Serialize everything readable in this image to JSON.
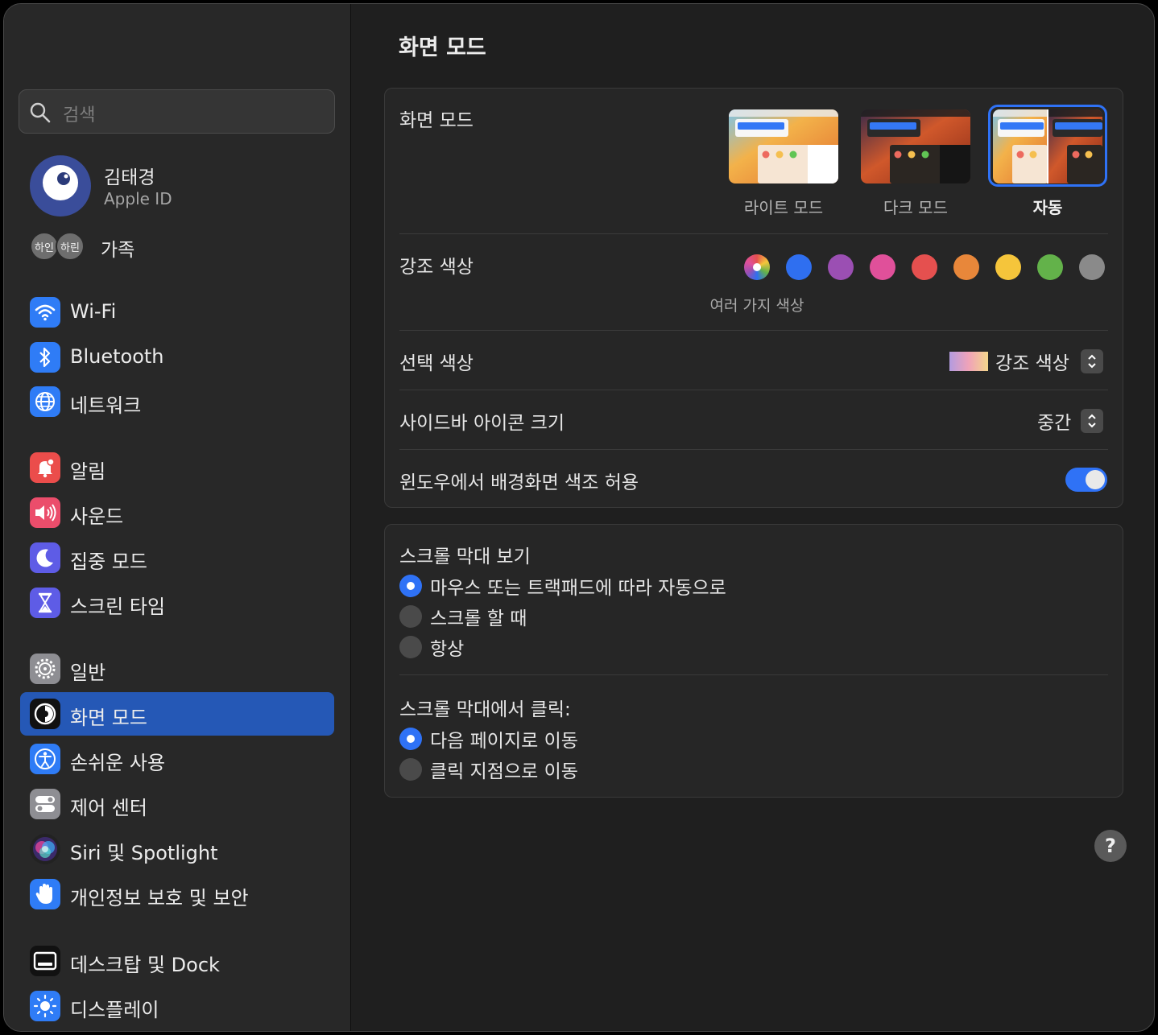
{
  "sidebar": {
    "search_placeholder": "검색",
    "profile": {
      "name": "김태경",
      "subtitle": "Apple ID"
    },
    "family": {
      "avatars": [
        "하인",
        "하린"
      ],
      "label": "가족"
    },
    "items": [
      {
        "label": "Wi-Fi",
        "icon": "wifi-icon",
        "color": "#2f7cf6"
      },
      {
        "label": "Bluetooth",
        "icon": "bluetooth-icon",
        "color": "#2f7cf6"
      },
      {
        "label": "네트워크",
        "icon": "globe-icon",
        "color": "#2f7cf6"
      },
      {
        "label": "알림",
        "icon": "bell-icon",
        "color": "#eb4d4b"
      },
      {
        "label": "사운드",
        "icon": "speaker-icon",
        "color": "#eb4d6b"
      },
      {
        "label": "집중 모드",
        "icon": "moon-icon",
        "color": "#5e5ce6"
      },
      {
        "label": "스크린 타임",
        "icon": "hourglass-icon",
        "color": "#5e5ce6"
      },
      {
        "label": "일반",
        "icon": "gear-icon",
        "color": "#8e8e93"
      },
      {
        "label": "화면 모드",
        "icon": "appearance-icon",
        "color": "#111111"
      },
      {
        "label": "손쉬운 사용",
        "icon": "accessibility-icon",
        "color": "#2f7cf6"
      },
      {
        "label": "제어 센터",
        "icon": "control-center-icon",
        "color": "#8e8e93"
      },
      {
        "label": "Siri 및 Spotlight",
        "icon": "siri-icon",
        "color": "#222222"
      },
      {
        "label": "개인정보 보호 및 보안",
        "icon": "hand-icon",
        "color": "#2f7cf6"
      },
      {
        "label": "데스크탑 및 Dock",
        "icon": "dock-icon",
        "color": "#111111"
      },
      {
        "label": "디스플레이",
        "icon": "sun-icon",
        "color": "#2f7cf6"
      }
    ]
  },
  "main": {
    "title": "화면 모드",
    "appearance": {
      "label": "화면 모드",
      "options": [
        {
          "label": "라이트 모드",
          "selected": false
        },
        {
          "label": "다크 모드",
          "selected": false
        },
        {
          "label": "자동",
          "selected": true
        }
      ]
    },
    "accent": {
      "label": "강조 색상",
      "caption": "여러 가지 색상",
      "colors": [
        "multicolor",
        "#2f6ff0",
        "#9b4fb3",
        "#e0509a",
        "#e5504f",
        "#e8873a",
        "#f5c53b",
        "#63b24a",
        "#8a8a8a"
      ]
    },
    "highlight": {
      "label": "선택 색상",
      "value": "강조 색상"
    },
    "sidebar_icon_size": {
      "label": "사이드바 아이콘 크기",
      "value": "중간"
    },
    "wallpaper_tinting": {
      "label": "윈도우에서 배경화면 색조 허용",
      "enabled": true
    },
    "scrollbars": {
      "label": "스크롤 막대 보기",
      "options": [
        {
          "label": "마우스 또는 트랙패드에 따라 자동으로",
          "selected": true
        },
        {
          "label": "스크롤 할 때",
          "selected": false
        },
        {
          "label": "항상",
          "selected": false
        }
      ]
    },
    "scroll_click": {
      "label": "스크롤 막대에서 클릭:",
      "options": [
        {
          "label": "다음 페이지로 이동",
          "selected": true
        },
        {
          "label": "클릭 지점으로 이동",
          "selected": false
        }
      ]
    },
    "help": "?"
  },
  "colors": {
    "accent": "#2f72f6",
    "selected_sidebar": "#2558b6",
    "window_bg": "#1f1f1f"
  }
}
